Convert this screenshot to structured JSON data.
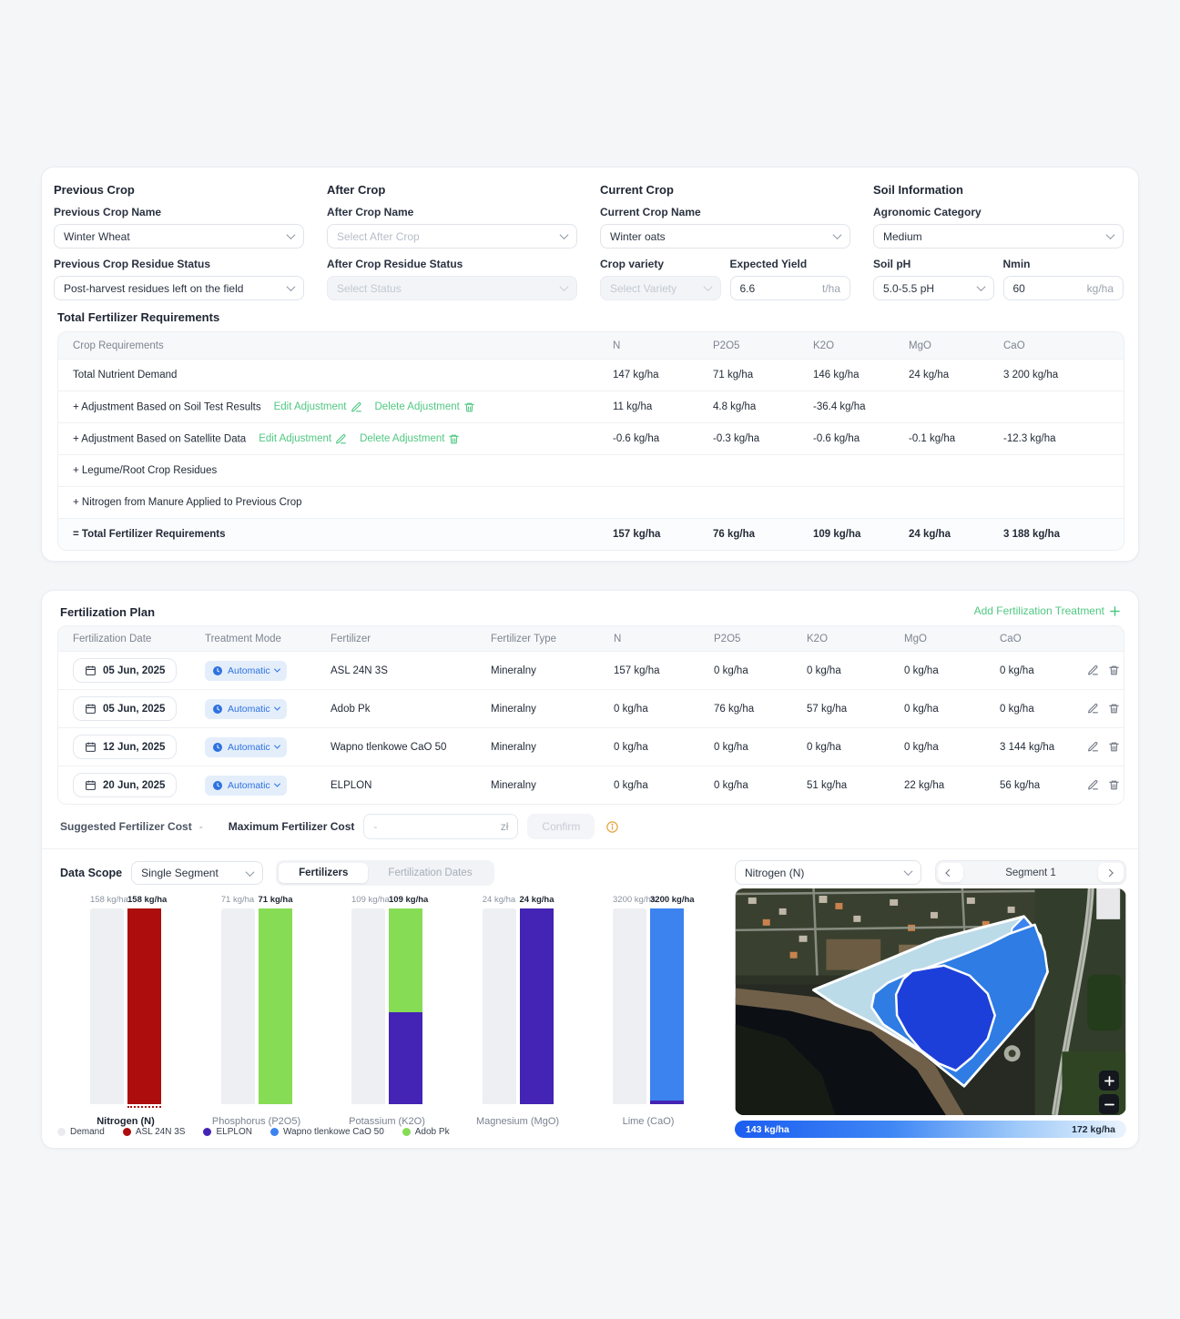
{
  "crop_form": {
    "sections": [
      {
        "title": "Previous Crop",
        "name_label": "Previous Crop Name",
        "name_value": "Winter Wheat",
        "residue_label": "Previous Crop Residue Status",
        "residue_value": "Post-harvest residues left on the field"
      },
      {
        "title": "After Crop",
        "name_label": "After Crop Name",
        "name_placeholder": "Select After Crop",
        "residue_label": "After Crop Residue Status",
        "residue_placeholder": "Select Status"
      },
      {
        "title": "Current Crop",
        "name_label": "Current Crop Name",
        "name_value": "Winter oats",
        "variety_label": "Crop variety",
        "variety_placeholder": "Select Variety",
        "yield_label": "Expected Yield",
        "yield_value": "6.6",
        "yield_suffix": "t/ha"
      },
      {
        "title": "Soil Information",
        "category_label": "Agronomic Category",
        "category_value": "Medium",
        "ph_label": "Soil pH",
        "ph_value": "5.0-5.5 pH",
        "nmin_label": "Nmin",
        "nmin_value": "60",
        "nmin_suffix": "kg/ha"
      }
    ]
  },
  "requirements": {
    "title": "Total Fertilizer Requirements",
    "columns": [
      "Crop Requirements",
      "N",
      "P2O5",
      "K2O",
      "MgO",
      "CaO"
    ],
    "edit_link": "Edit Adjustment",
    "delete_link": "Delete Adjustment",
    "rows": [
      {
        "label": "Total Nutrient Demand",
        "links": false,
        "values": [
          "147 kg/ha",
          "71 kg/ha",
          "146 kg/ha",
          "24 kg/ha",
          "3 200 kg/ha"
        ],
        "total": false
      },
      {
        "label": "+ Adjustment Based on Soil Test Results",
        "links": true,
        "values": [
          "11 kg/ha",
          "4.8 kg/ha",
          "-36.4 kg/ha",
          "",
          ""
        ],
        "total": false
      },
      {
        "label": "+ Adjustment Based on Satellite Data",
        "links": true,
        "values": [
          "-0.6 kg/ha",
          "-0.3 kg/ha",
          "-0.6 kg/ha",
          "-0.1 kg/ha",
          "-12.3 kg/ha"
        ],
        "total": false
      },
      {
        "label": "+ Legume/Root Crop Residues",
        "links": false,
        "values": [
          "",
          "",
          "",
          "",
          ""
        ],
        "total": false
      },
      {
        "label": "+ Nitrogen from Manure Applied to Previous Crop",
        "links": false,
        "values": [
          "",
          "",
          "",
          "",
          ""
        ],
        "total": false
      },
      {
        "label": "= Total Fertilizer Requirements",
        "links": false,
        "values": [
          "157 kg/ha",
          "76 kg/ha",
          "109 kg/ha",
          "24 kg/ha",
          "3 188 kg/ha"
        ],
        "total": true
      }
    ]
  },
  "plan": {
    "title": "Fertilization Plan",
    "add_link": "Add Fertilization Treatment",
    "columns": [
      "Fertilization Date",
      "Treatment Mode",
      "Fertilizer",
      "Fertilizer Type",
      "N",
      "P2O5",
      "K2O",
      "MgO",
      "CaO"
    ],
    "rows": [
      {
        "date": "05 Jun, 2025",
        "mode": "Automatic",
        "fertilizer": "ASL 24N 3S",
        "type": "Mineralny",
        "values": [
          "157 kg/ha",
          "0 kg/ha",
          "0 kg/ha",
          "0 kg/ha",
          "0 kg/ha"
        ]
      },
      {
        "date": "05 Jun, 2025",
        "mode": "Automatic",
        "fertilizer": "Adob Pk",
        "type": "Mineralny",
        "values": [
          "0 kg/ha",
          "76 kg/ha",
          "57 kg/ha",
          "0 kg/ha",
          "0 kg/ha"
        ]
      },
      {
        "date": "12 Jun, 2025",
        "mode": "Automatic",
        "fertilizer": "Wapno tlenkowe CaO 50",
        "type": "Mineralny",
        "values": [
          "0 kg/ha",
          "0 kg/ha",
          "0 kg/ha",
          "0 kg/ha",
          "3 144 kg/ha"
        ]
      },
      {
        "date": "20 Jun, 2025",
        "mode": "Automatic",
        "fertilizer": "ELPLON",
        "type": "Mineralny",
        "values": [
          "0 kg/ha",
          "0 kg/ha",
          "51 kg/ha",
          "22 kg/ha",
          "56 kg/ha"
        ]
      }
    ],
    "cost": {
      "suggested_label": "Suggested Fertilizer Cost",
      "suggested_value": "-",
      "max_label": "Maximum Fertilizer Cost",
      "input_placeholder": "-",
      "currency": "zł",
      "confirm_label": "Confirm"
    }
  },
  "scope": {
    "label": "Data Scope",
    "selected": "Single Segment",
    "tabs": [
      "Fertilizers",
      "Fertilization Dates"
    ],
    "active_tab": "Fertilizers"
  },
  "chart_data": {
    "type": "bar",
    "subtype": "grouped demand vs applied, applied stacked by fertilizer",
    "categories": [
      "Nitrogen (N)",
      "Phosphorus (P2O5)",
      "Potassium (K2O)",
      "Magnesium (MgO)",
      "Lime (CaO)"
    ],
    "highlighted_category": "Nitrogen (N)",
    "demand_values": [
      158,
      71,
      109,
      24,
      3200
    ],
    "applied_totals": [
      158,
      71,
      109,
      24,
      3200
    ],
    "demand_labels": [
      "158 kg/ha",
      "71 kg/ha",
      "109 kg/ha",
      "24 kg/ha",
      "3200 kg/ha"
    ],
    "applied_labels": [
      "158 kg/ha",
      "71 kg/ha",
      "109 kg/ha",
      "24 kg/ha",
      "3200 kg/ha"
    ],
    "ylabel": "kg/ha",
    "series": [
      {
        "name": "ELPLON",
        "color": "#4424b4",
        "values": [
          0,
          0,
          51,
          24,
          56
        ]
      },
      {
        "name": "Wapno tlenkowe CaO 50",
        "color": "#3c83f0",
        "values": [
          0,
          0,
          0,
          0,
          3144
        ]
      },
      {
        "name": "Adob Pk",
        "color": "#87dc55",
        "values": [
          0,
          71,
          58,
          0,
          0
        ]
      },
      {
        "name": "ASL 24N 3S",
        "color": "#ad0d0d",
        "values": [
          158,
          0,
          0,
          0,
          0
        ]
      }
    ],
    "demand_color": "#edeff3",
    "legend": [
      {
        "name": "Demand",
        "color": "#e9ebef"
      },
      {
        "name": "ASL 24N 3S",
        "color": "#ad0d0d"
      },
      {
        "name": "ELPLON",
        "color": "#4424b4"
      },
      {
        "name": "Wapno tlenkowe CaO 50",
        "color": "#3c83f0"
      },
      {
        "name": "Adob Pk",
        "color": "#87dc55"
      }
    ]
  },
  "map": {
    "nutrient_selected": "Nitrogen (N)",
    "segment_label": "Segment 1",
    "legend_min": "143 kg/ha",
    "legend_max": "172 kg/ha"
  },
  "colors": {
    "accent_green": "#50c882",
    "accent_blue": "#2d72e0",
    "info_orange": "#e8a33d",
    "zone_pale": "#bcdbe9",
    "zone_mid": "#2e7ce4",
    "zone_dark": "#1d3fd9"
  }
}
